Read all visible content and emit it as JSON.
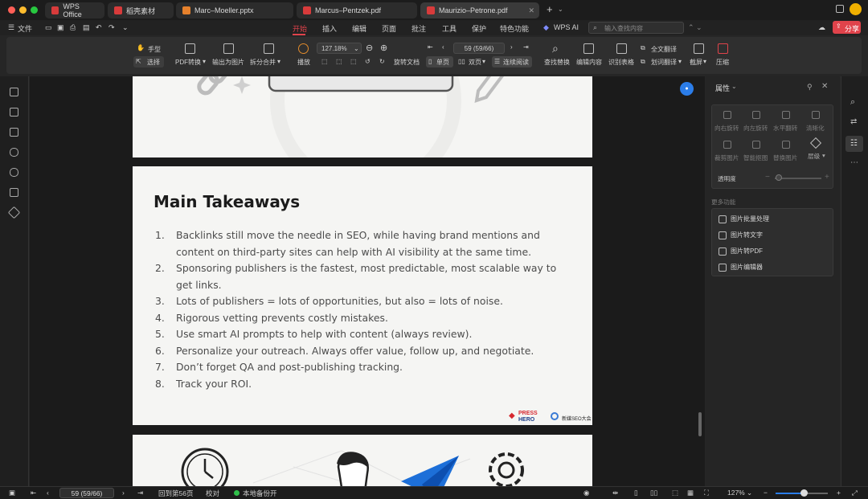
{
  "titlebar": {
    "tabs": [
      {
        "label": "WPS Office",
        "color": "#d83b3b"
      },
      {
        "label": "稻壳素材",
        "color": "#d83b3b"
      },
      {
        "label": "Marc–Moeller.pptx",
        "color": "#e6812c"
      },
      {
        "label": "Marcus–Pentzek.pdf",
        "color": "#d83b3b"
      },
      {
        "label": "Maurizio–Petrone.pdf",
        "color": "#d83b3b"
      }
    ],
    "new_tab": "+"
  },
  "menubar": {
    "file": "文件",
    "items": [
      "开始",
      "插入",
      "编辑",
      "页面",
      "批注",
      "工具",
      "保护",
      "特色功能"
    ],
    "wps_ai": "WPS AI",
    "search_placeholder": "输入查找内容",
    "share": "分享"
  },
  "ribbon": {
    "hand": "手型",
    "select": "选择",
    "pdf_convert": "PDF转换",
    "export_image": "输出为图片",
    "split_merge": "拆分合并",
    "play": "播放",
    "zoom_value": "127.18%",
    "page_value": "59 (59/66)",
    "rotate": "旋转文档",
    "single": "单页",
    "double": "双页",
    "continuous": "连续阅读",
    "find_replace": "查找替换",
    "edit_content": "编辑内容",
    "recognize_table": "识别表格",
    "full_translate": "全文翻译",
    "word_translate": "划词翻译",
    "screenshot": "截屏",
    "compress": "压缩"
  },
  "document": {
    "title": "Main Takeaways",
    "items": [
      {
        "n": "1.",
        "text": "Backlinks still move the needle in SEO, while having brand mentions and content on third-party sites can help with AI visibility at the same time."
      },
      {
        "n": "2.",
        "text": "Sponsoring publishers is the fastest, most predictable, most scalable way to get links."
      },
      {
        "n": "3.",
        "text": "Lots of publishers = lots of opportunities, but also = lots of noise."
      },
      {
        "n": "4.",
        "text": "Rigorous vetting prevents costly mistakes."
      },
      {
        "n": "5.",
        "text": "Use smart AI prompts to help with content (always review)."
      },
      {
        "n": "6.",
        "text": "Personalize your outreach. Always offer value, follow up, and negotiate."
      },
      {
        "n": "7.",
        "text": "Don’t forget QA and post-publishing tracking."
      },
      {
        "n": "8.",
        "text": "Track your ROI."
      }
    ],
    "logo1_line1": "PRESS",
    "logo1_line2": "HERO",
    "logo2_text": "新媒SEO大会"
  },
  "panel": {
    "title": "属性",
    "rotate_right": "向右旋转",
    "rotate_left": "向左旋转",
    "flip_h": "水平翻转",
    "sharpen": "清晰化",
    "crop": "裁剪图片",
    "smart_cutout": "智能抠图",
    "replace": "替换图片",
    "layer": "层级",
    "opacity": "透明度",
    "more": "更多功能",
    "batch": "图片批量处理",
    "to_text": "图片转文字",
    "to_pdf": "图片转PDF",
    "editor": "图片编辑器"
  },
  "status": {
    "page": "59 (59/66)",
    "back": "回到第56页",
    "proof": "校对",
    "backup": "本地备份开",
    "zoom": "127%"
  },
  "colors": {
    "accent": "#e0434b",
    "page": "#f5f5f3",
    "doc_text": "#4c4c4c"
  }
}
